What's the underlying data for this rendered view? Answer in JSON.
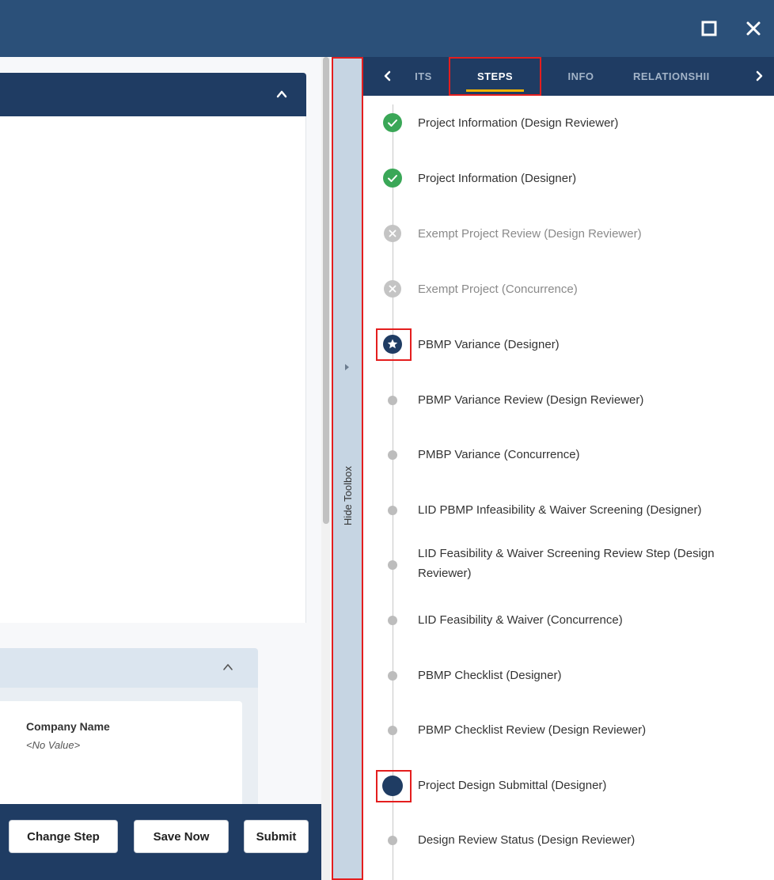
{
  "colors": {
    "titlebar": "#2b5079",
    "navy": "#1f3c63",
    "accent_red": "#e41e1e",
    "success": "#3aa757",
    "pending": "#bdbdbd",
    "tab_underline": "#f4b400"
  },
  "window": {
    "maximize_icon": "maximize-icon",
    "close_icon": "close-icon"
  },
  "form": {
    "subsection_field_label": "Company Name",
    "subsection_field_value": "<No Value>"
  },
  "actions": {
    "change_step": "Change Step",
    "save_now": "Save Now",
    "submit": "Submit"
  },
  "toolbox": {
    "label": "Hide Toolbox"
  },
  "tabs": {
    "items": [
      {
        "label": "ITS"
      },
      {
        "label": "STEPS",
        "active": true
      },
      {
        "label": "INFO"
      },
      {
        "label": "RELATIONSHII"
      }
    ]
  },
  "steps": [
    {
      "label": "Project Information (Design Reviewer)",
      "status": "completed"
    },
    {
      "label": "Project Information (Designer)",
      "status": "completed"
    },
    {
      "label": "Exempt Project Review (Design Reviewer)",
      "status": "skipped"
    },
    {
      "label": "Exempt Project (Concurrence)",
      "status": "skipped"
    },
    {
      "label": "PBMP Variance (Designer)",
      "status": "current"
    },
    {
      "label": "PBMP Variance Review (Design Reviewer)",
      "status": "pending"
    },
    {
      "label": "PMBP Variance (Concurrence)",
      "status": "pending"
    },
    {
      "label": "LID PBMP Infeasibility & Waiver Screening (Designer)",
      "status": "pending"
    },
    {
      "label": "LID Feasibility & Waiver Screening Review Step (Design Reviewer)",
      "status": "pending"
    },
    {
      "label": "LID Feasibility & Waiver (Concurrence)",
      "status": "pending"
    },
    {
      "label": "PBMP Checklist (Designer)",
      "status": "pending"
    },
    {
      "label": "PBMP Checklist Review (Design Reviewer)",
      "status": "pending"
    },
    {
      "label": "Project Design Submittal (Designer)",
      "status": "selected"
    },
    {
      "label": "Design Review Status (Design Reviewer)",
      "status": "pending"
    }
  ]
}
